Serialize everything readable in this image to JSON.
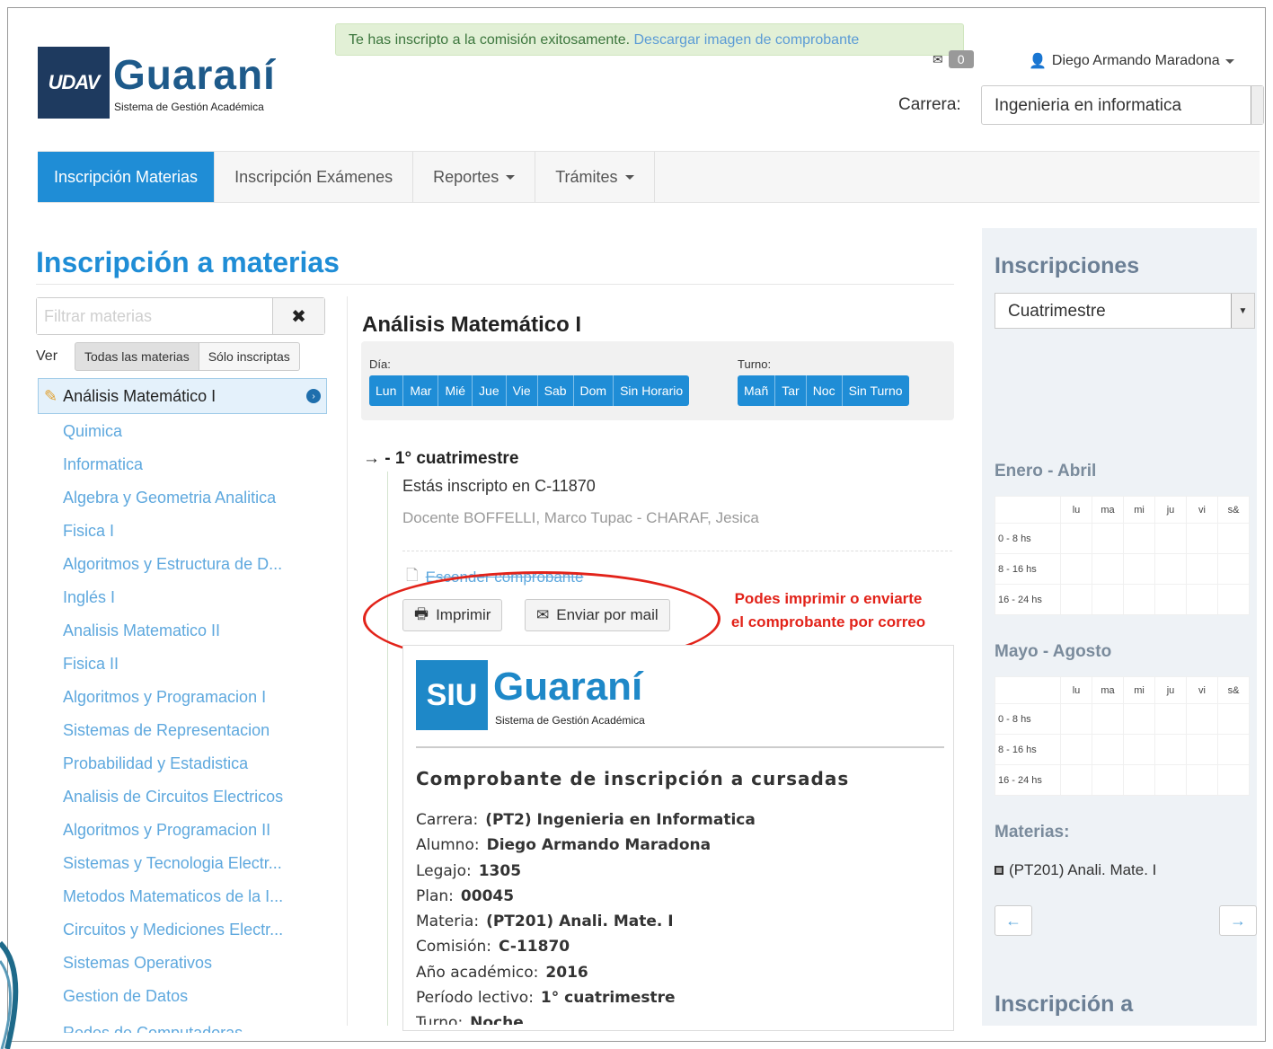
{
  "alert": {
    "text": "Te has inscripto a la comisión exitosamente.",
    "link": "Descargar imagen de comprobante"
  },
  "logo": {
    "mark": "UDAV",
    "word": "Guaraní",
    "subtitle": "Sistema de Gestión Académica"
  },
  "mail": {
    "count": "0"
  },
  "user": {
    "name": "Diego Armando Maradona"
  },
  "carrera": {
    "label": "Carrera:",
    "value": "Ingenieria en informatica"
  },
  "nav": {
    "items": [
      {
        "label": "Inscripción Materias"
      },
      {
        "label": "Inscripción Exámenes"
      },
      {
        "label": "Reportes"
      },
      {
        "label": "Trámites"
      }
    ]
  },
  "page": {
    "title": "Inscripción a materias"
  },
  "sidebar": {
    "filter_placeholder": "Filtrar materias",
    "ver_label": "Ver",
    "ver_options": [
      "Todas las materias",
      "Sólo inscriptas"
    ],
    "selected": "Análisis Matemático I",
    "materias": [
      "Quimica",
      "Informatica",
      "Algebra y Geometria Analitica",
      "Fisica I",
      "Algoritmos y Estructura de D...",
      "Inglés I",
      "Analisis Matematico II",
      "Fisica II",
      "Algoritmos y Programacion I",
      "Sistemas de Representacion",
      "Probabilidad y Estadistica",
      "Analisis de Circuitos Electricos",
      "Algoritmos y Programacion II",
      "Sistemas y Tecnologia Electr...",
      "Metodos Matematicos de la I...",
      "Circuitos y Mediciones Electr...",
      "Sistemas Operativos",
      "Gestion de Datos",
      "Redes de Computadoras"
    ]
  },
  "subject": {
    "title": "Análisis Matemático I",
    "dia_label": "Día:",
    "dias": [
      "Lun",
      "Mar",
      "Mié",
      "Jue",
      "Vie",
      "Sab",
      "Dom",
      "Sin Horario"
    ],
    "turno_label": "Turno:",
    "turnos": [
      "Mañ",
      "Tar",
      "Noc",
      "Sin Turno"
    ],
    "period": "→ - 1° cuatrimestre",
    "inscripto": "Estás inscripto en C-11870",
    "docente": "Docente BOFFELLI, Marco Tupac - CHARAF, Jesica",
    "esconder": "Esconder comprobante",
    "print": "Imprimir",
    "email": "Enviar por mail",
    "annotation": "Podes imprimir o enviarte el comprobante por correo"
  },
  "comprobante": {
    "logo_mark": "SIU",
    "logo_word": "Guaraní",
    "logo_sub": "Sistema de Gestión Académica",
    "title": "Comprobante de inscripción a cursadas",
    "rows": [
      {
        "label": "Carrera:",
        "value": "(PT2) Ingenieria en Informatica"
      },
      {
        "label": "Alumno:",
        "value": "Diego Armando Maradona"
      },
      {
        "label": "Legajo:",
        "value": "1305"
      },
      {
        "label": "Plan:",
        "value": "00045"
      },
      {
        "label": "Materia:",
        "value": "(PT201) Anali. Mate. I"
      },
      {
        "label": "Comisión:",
        "value": "C-11870"
      },
      {
        "label": "Año académico:",
        "value": "2016"
      },
      {
        "label": "Período lectivo:",
        "value": "1° cuatrimestre"
      },
      {
        "label": "Turno:",
        "value": "Noche"
      }
    ]
  },
  "right": {
    "title": "Inscripciones",
    "period_select": "Cuatrimestre",
    "days": [
      "lu",
      "ma",
      "mi",
      "ju",
      "vi",
      "s&"
    ],
    "ranges": [
      "0 - 8 hs",
      "8 - 16 hs",
      "16 - 24 hs"
    ],
    "sec1": "Enero - Abril",
    "sec2": "Mayo - Agosto",
    "materias_title": "Materias:",
    "materia_item": "(PT201) Anali. Mate. I",
    "prev": "←",
    "next": "→",
    "bottom_title": "Inscripción a"
  }
}
